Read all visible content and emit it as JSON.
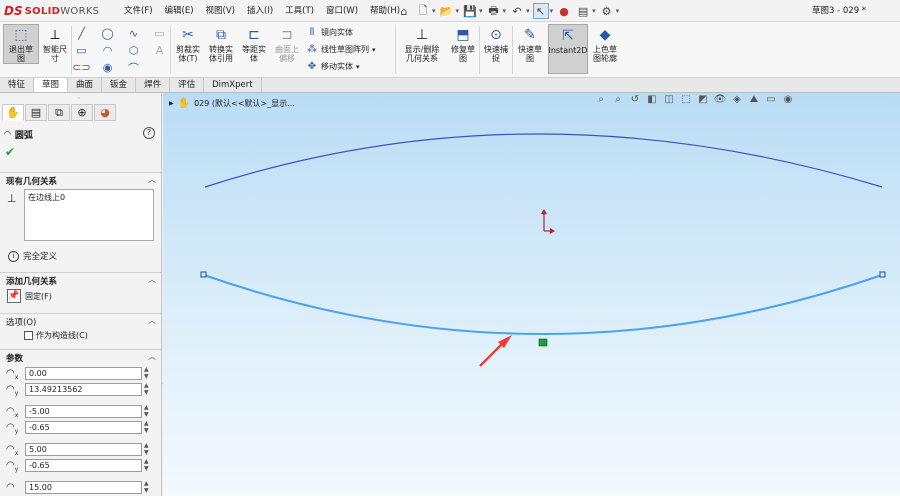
{
  "app": {
    "logo_ds": "DS",
    "logo_solid": "SOLID",
    "logo_works": "WORKS",
    "doc_title": "草图3 - 029 *"
  },
  "menu": [
    "文件(F)",
    "编辑(E)",
    "视图(V)",
    "插入(I)",
    "工具(T)",
    "窗口(W)",
    "帮助(H)"
  ],
  "ribbon": {
    "exit_sketch": "退出草\n图",
    "smart_dim": "智能尺\n寸",
    "trim": "剪裁实\n体(T)",
    "convert": "转换实\n体引用",
    "offset": "等距实\n体",
    "offset_surface": "曲面上\n偏移",
    "mirror": "镜向实体",
    "linear_pattern": "线性草图阵列",
    "move": "移动实体",
    "show_relations": "显示/删除\n几何关系",
    "repair": "修复草\n图",
    "quick_snap": "快速捕\n捉",
    "rapid_sketch": "快速草\n图",
    "instant2d": "Instant2D",
    "shaded_sketch": "上色草\n图轮廓"
  },
  "tabs": [
    "特征",
    "草图",
    "曲面",
    "钣金",
    "焊件",
    "评估",
    "DimXpert"
  ],
  "active_tab": "草图",
  "feature_tree": {
    "root": "029 (默认<<默认>_显示..."
  },
  "property_manager": {
    "title": "圆弧",
    "existing_relations": {
      "header": "现有几何关系",
      "items": [
        "在边线上0"
      ]
    },
    "status": "完全定义",
    "add_relations": {
      "header": "添加几何关系",
      "fix_label": "固定(F)"
    },
    "options": {
      "header": "选项(O)",
      "construction_label": "作为构造线(C)"
    },
    "parameters": {
      "header": "参数",
      "values": [
        "0.00",
        "13.49213562",
        "-5.00",
        "-0.65",
        "5.00",
        "-0.65",
        "15.00"
      ]
    }
  }
}
